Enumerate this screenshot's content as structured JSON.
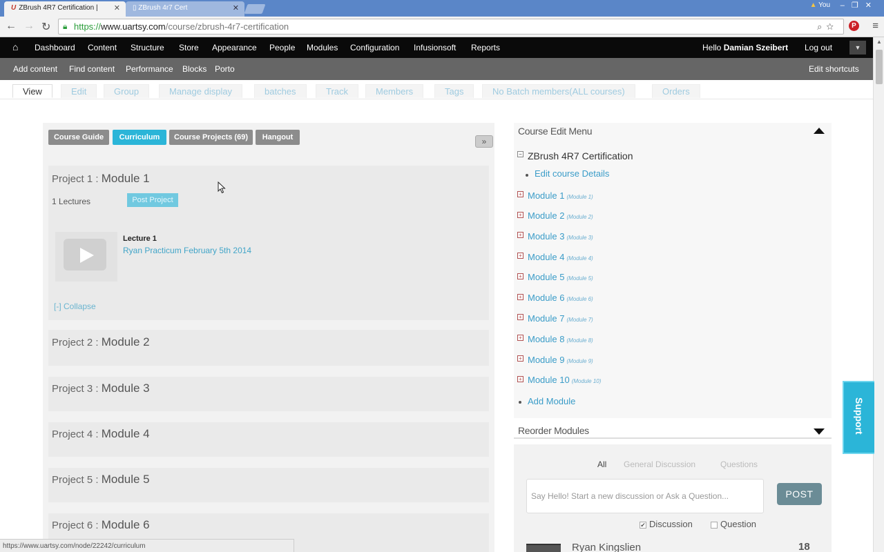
{
  "browser": {
    "tabs": [
      {
        "label": "ZBrush 4R7 Certification |",
        "logo": "U"
      },
      {
        "label": "ZBrush 4r7 Cert"
      }
    ],
    "user_chip": "You",
    "url": {
      "scheme": "https://",
      "host": "www.uartsy.com",
      "path": "/course/zbrush-4r7-certification"
    },
    "status_url": "https://www.uartsy.com/node/22242/curriculum"
  },
  "admin_menu": {
    "items": [
      "Dashboard",
      "Content",
      "Structure",
      "Store",
      "Appearance",
      "People",
      "Modules",
      "Configuration",
      "Infusionsoft",
      "Reports"
    ],
    "hello_prefix": "Hello",
    "user_name": "Damian Szeibert",
    "logout": "Log out"
  },
  "shortcuts": {
    "items": [
      "Add content",
      "Find content",
      "Performance",
      "Blocks",
      "Porto"
    ],
    "edit": "Edit shortcuts"
  },
  "page_tabs": [
    "View",
    "Edit",
    "Group",
    "Manage display",
    "batches",
    "Track",
    "Members",
    "Tags",
    "No Batch members(ALL courses)",
    "Orders"
  ],
  "course_buttons": [
    {
      "label": "Course Guide",
      "active": false
    },
    {
      "label": "Curriculum",
      "active": true
    },
    {
      "label": "Course Projects (69)",
      "active": false
    },
    {
      "label": "Hangout",
      "active": false
    }
  ],
  "expand_label": "»",
  "projects": [
    {
      "prefix": "Project 1 :",
      "module": "Module 1"
    },
    {
      "prefix": "Project 2 :",
      "module": "Module 2"
    },
    {
      "prefix": "Project 3 :",
      "module": "Module 3"
    },
    {
      "prefix": "Project 4 :",
      "module": "Module 4"
    },
    {
      "prefix": "Project 5 :",
      "module": "Module 5"
    },
    {
      "prefix": "Project 6 :",
      "module": "Module 6"
    }
  ],
  "project1": {
    "lectures_count": "1 Lectures",
    "post_project": "Post Project",
    "lecture_label": "Lecture 1",
    "lecture_link": "Ryan Practicum February 5th 2014",
    "collapse": "[-] Collapse"
  },
  "edit_menu": {
    "title": "Course Edit Menu",
    "course_name": "ZBrush 4R7 Certification",
    "edit_details": "Edit course Details",
    "modules": [
      {
        "label": "Module 1",
        "sub": "(Module 1)"
      },
      {
        "label": "Module 2",
        "sub": "(Module 2)"
      },
      {
        "label": "Module 3",
        "sub": "(Module 3)"
      },
      {
        "label": "Module 4",
        "sub": "(Module 4)"
      },
      {
        "label": "Module 5",
        "sub": "(Module 5)"
      },
      {
        "label": "Module 6",
        "sub": "(Module 6)"
      },
      {
        "label": "Module 7",
        "sub": "(Module 7)"
      },
      {
        "label": "Module 8",
        "sub": "(Module 8)"
      },
      {
        "label": "Module 9",
        "sub": "(Module 9)"
      },
      {
        "label": "Module 10",
        "sub": "(Module 10)"
      }
    ],
    "add_module": "Add Module",
    "reorder": "Reorder Modules"
  },
  "discussion": {
    "tabs": [
      "All",
      "General Discussion",
      "Questions"
    ],
    "placeholder": "Say Hello! Start a new discussion or Ask a Question...",
    "post_button": "POST",
    "checkbox_discussion": "Discussion",
    "checkbox_question": "Question",
    "discussion_checked": true,
    "question_checked": false,
    "first_user": "Ryan Kingslien",
    "first_count": "18"
  },
  "support_label": "Support",
  "colors": {
    "accent": "#2bb5d8",
    "link": "#3a9cc8",
    "admin_bar": "#0a0a0a",
    "shortcut_bar": "#666666"
  }
}
